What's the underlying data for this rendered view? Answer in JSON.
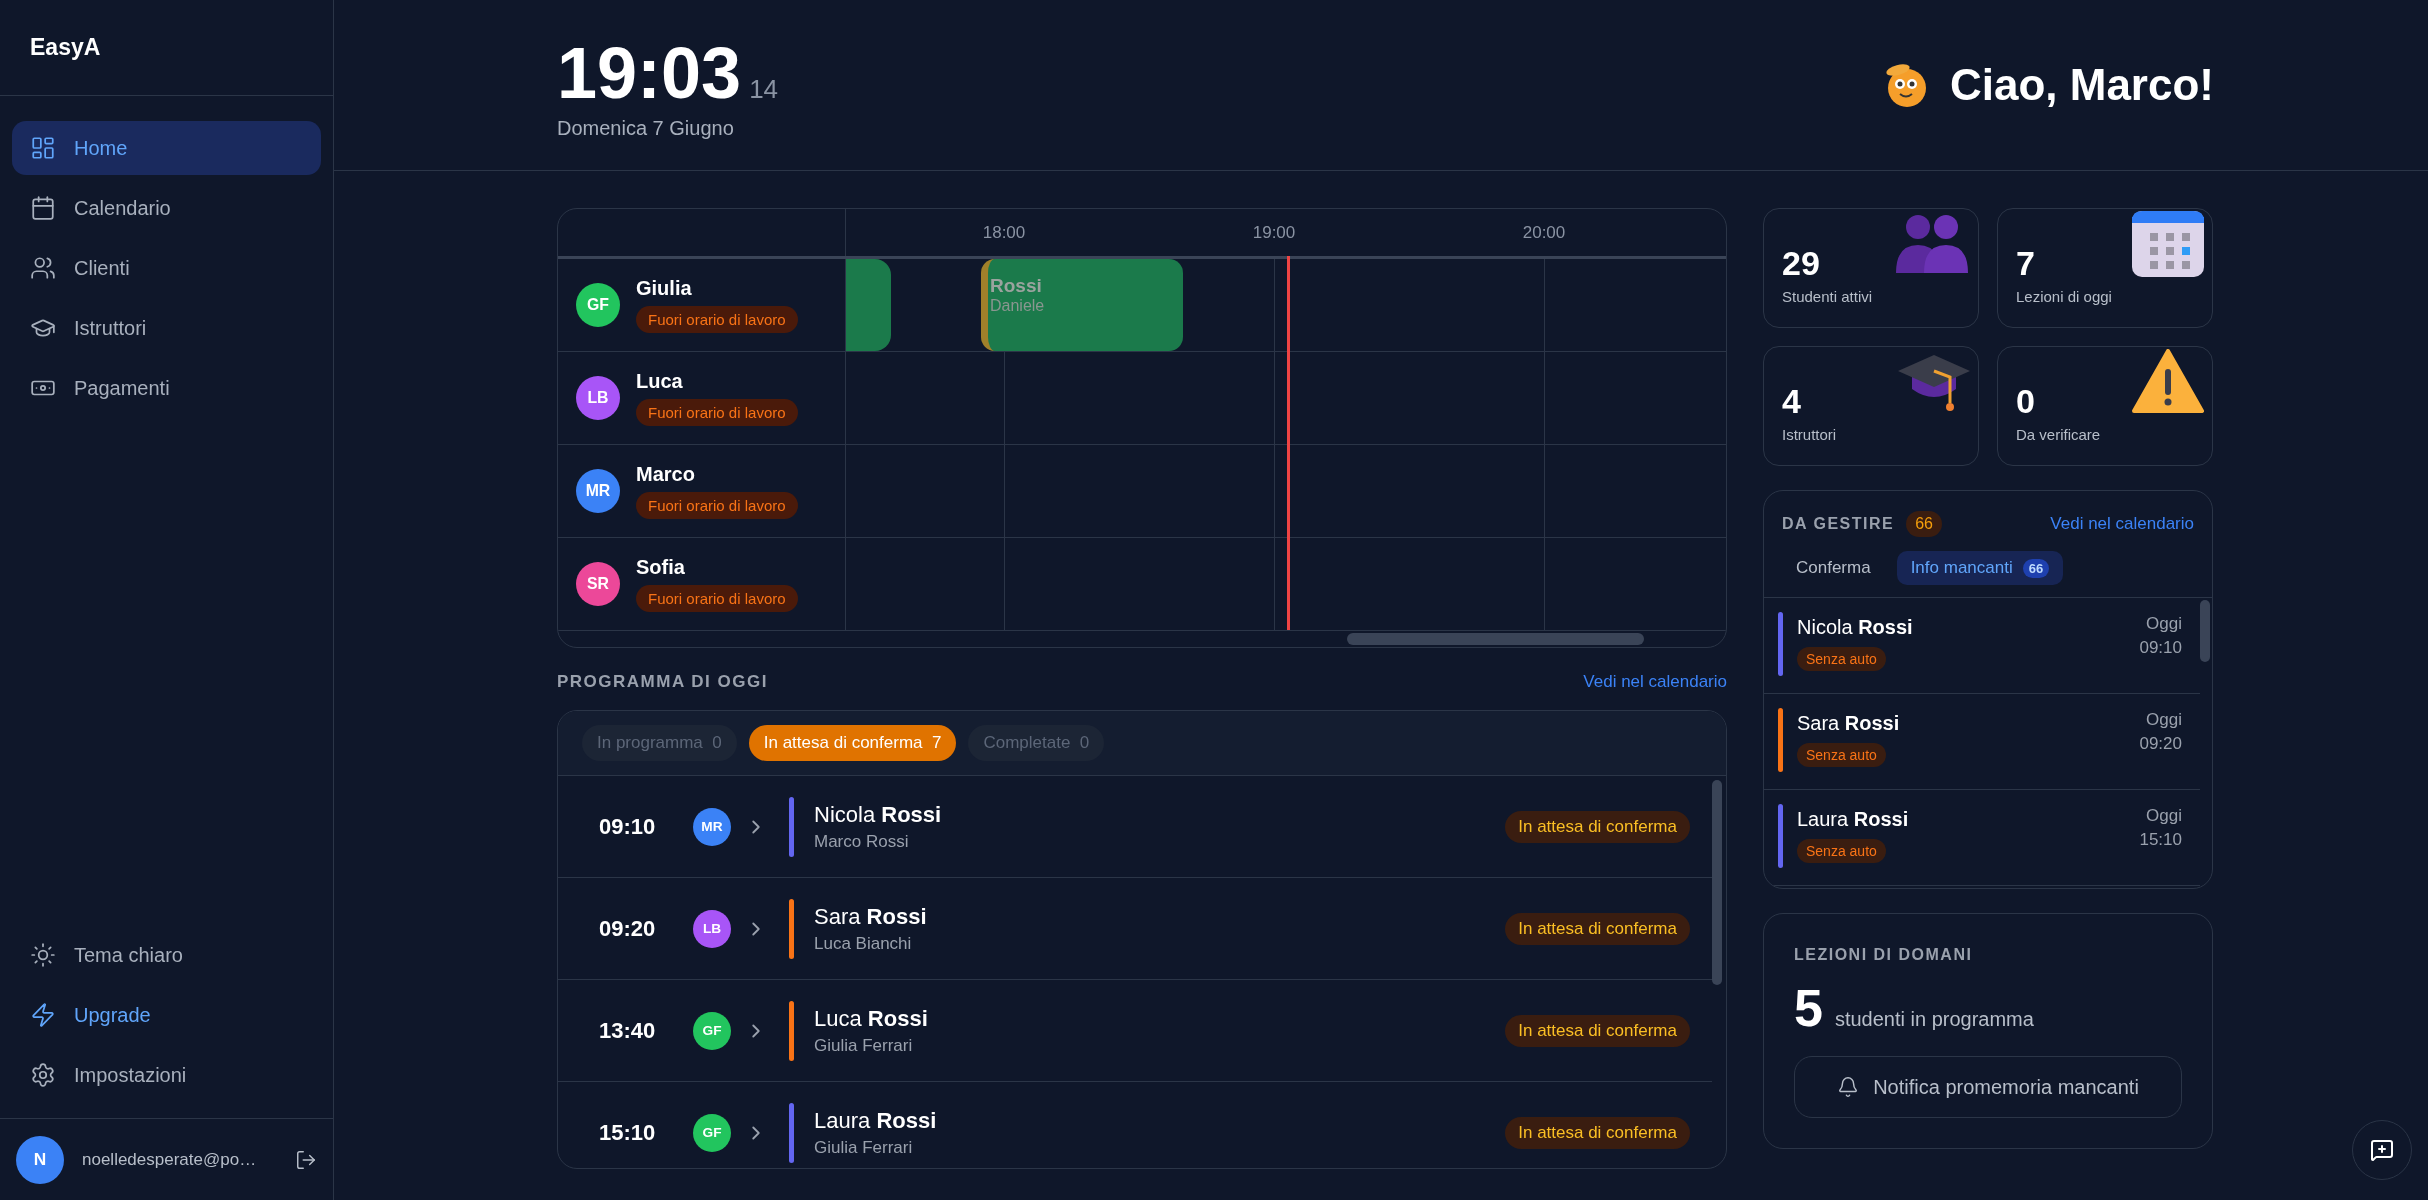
{
  "sidebar": {
    "logo": "EasyA",
    "nav": [
      {
        "label": "Home",
        "selected": true
      },
      {
        "label": "Calendario",
        "selected": false
      },
      {
        "label": "Clienti",
        "selected": false
      },
      {
        "label": "Istruttori",
        "selected": false
      },
      {
        "label": "Pagamenti",
        "selected": false
      }
    ],
    "footer_items": [
      {
        "label": "Tema chiaro",
        "highlighted": false
      },
      {
        "label": "Upgrade",
        "highlighted": true
      },
      {
        "label": "Impostazioni",
        "highlighted": false
      }
    ],
    "user": {
      "initial": "N",
      "email": "noelledesperate@po…"
    }
  },
  "header": {
    "time": "19:03",
    "seconds": "14",
    "date": "Domenica 7 Giugno",
    "greeting": "Ciao, Marco!"
  },
  "timeline": {
    "hours": [
      "18:00",
      "19:00",
      "20:00"
    ],
    "instructors": [
      {
        "initials": "GF",
        "name": "Giulia",
        "color": "#22c55e",
        "status": "Fuori orario di lavoro",
        "events": [
          {
            "kind": "cut"
          },
          {
            "kind": "lesson",
            "title": "Rossi",
            "subtitle": "Daniele"
          }
        ]
      },
      {
        "initials": "LB",
        "name": "Luca",
        "color": "#a855f7",
        "status": "Fuori orario di lavoro"
      },
      {
        "initials": "MR",
        "name": "Marco",
        "color": "#3b82f6",
        "status": "Fuori orario di lavoro"
      },
      {
        "initials": "SR",
        "name": "Sofia",
        "color": "#ec4899",
        "status": "Fuori orario di lavoro"
      }
    ]
  },
  "schedule": {
    "title": "PROGRAMMA DI OGGI",
    "link": "Vedi nel calendario",
    "filters": [
      {
        "label": "In programma",
        "count": "0",
        "selected": false
      },
      {
        "label": "In attesa di conferma",
        "count": "7",
        "selected": true
      },
      {
        "label": "Completate",
        "count": "0",
        "selected": false
      }
    ],
    "rows": [
      {
        "time": "09:10",
        "avatar": {
          "initials": "MR",
          "color": "#3b82f6"
        },
        "student": "Nicola **Rossi**",
        "instructor": "Marco Rossi",
        "color": "#6366f1",
        "status": "In attesa di conferma"
      },
      {
        "time": "09:20",
        "avatar": {
          "initials": "LB",
          "color": "#a855f7"
        },
        "student": "Sara **Rossi**",
        "instructor": "Luca Bianchi",
        "color": "#f97316",
        "status": "In attesa di conferma"
      },
      {
        "time": "13:40",
        "avatar": {
          "initials": "GF",
          "color": "#22c55e"
        },
        "student": "Luca **Rossi**",
        "instructor": "Giulia Ferrari",
        "color": "#f97316",
        "status": "In attesa di conferma"
      },
      {
        "time": "15:10",
        "avatar": {
          "initials": "GF",
          "color": "#22c55e"
        },
        "student": "Laura **Rossi**",
        "instructor": "Giulia Ferrari",
        "color": "#6366f1",
        "status": "In attesa di conferma"
      }
    ]
  },
  "stats": [
    {
      "value": "29",
      "label": "Studenti attivi",
      "kind": "students"
    },
    {
      "value": "7",
      "label": "Lezioni di oggi",
      "kind": "calendar"
    },
    {
      "value": "4",
      "label": "Istruttori",
      "kind": "cap"
    },
    {
      "value": "0",
      "label": "Da verificare",
      "kind": "warning"
    }
  ],
  "to_manage": {
    "title": "DA GESTIRE",
    "count": "66",
    "link": "Vedi nel calendario",
    "tabs": [
      {
        "label": "Conferma",
        "selected": false
      },
      {
        "label": "Info mancanti",
        "count": "66",
        "selected": true
      }
    ],
    "items": [
      {
        "name": "Nicola **Rossi**",
        "tag": "Senza auto",
        "day": "Oggi",
        "time": "09:10",
        "color": "#6366f1"
      },
      {
        "name": "Sara **Rossi**",
        "tag": "Senza auto",
        "day": "Oggi",
        "time": "09:20",
        "color": "#f97316"
      },
      {
        "name": "Laura **Rossi**",
        "tag": "Senza auto",
        "day": "Oggi",
        "time": "15:10",
        "color": "#6366f1"
      }
    ]
  },
  "tomorrow": {
    "title": "LEZIONI DI DOMANI",
    "count": "5",
    "label": "studenti in programma",
    "button": "Notifica promemoria mancanti"
  }
}
